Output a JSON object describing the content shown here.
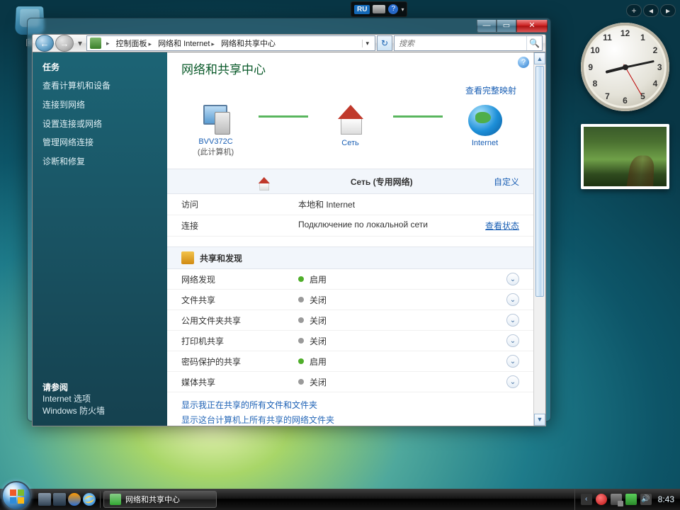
{
  "desktop": {
    "recycle_bin": "回"
  },
  "langbar": {
    "lang": "RU"
  },
  "window": {
    "breadcrumb": {
      "p1": "",
      "p2": "控制面板",
      "p3": "网络和 Internet",
      "p4": "网络和共享中心"
    },
    "search_placeholder": "搜索"
  },
  "sidebar": {
    "tasks_heading": "任务",
    "links": {
      "a": "查看计算机和设备",
      "b": "连接到网络",
      "c": "设置连接或网络",
      "d": "管理网络连接",
      "e": "诊断和修复"
    },
    "seealso": {
      "heading": "请参阅",
      "a": "Internet 选项",
      "b": "Windows 防火墙"
    }
  },
  "main": {
    "title": "网络和共享中心",
    "view_full_map": "查看完整映射",
    "map": {
      "pc": "BVV372C",
      "pc_sub": "(此计算机)",
      "net": "Сеть",
      "inet": "Internet"
    },
    "net_section": {
      "title": "Сеть (专用网络)",
      "customize": "自定义"
    },
    "kv": {
      "access_k": "访问",
      "access_v": "本地和 Internet",
      "conn_k": "连接",
      "conn_v": "Подключение по локальной сети",
      "view_status": "查看状态"
    },
    "share_section": "共享和发现",
    "rows": {
      "r1k": "网络发现",
      "r1v": "启用",
      "r2k": "文件共享",
      "r2v": "关闭",
      "r3k": "公用文件夹共享",
      "r3v": "关闭",
      "r4k": "打印机共享",
      "r4v": "关闭",
      "r5k": "密码保护的共享",
      "r5v": "启用",
      "r6k": "媒体共享",
      "r6v": "关闭"
    },
    "bottom": {
      "a": "显示我正在共享的所有文件和文件夹",
      "b": "显示这台计算机上所有共享的网络文件夹"
    }
  },
  "taskbar": {
    "active": "网络和共享中心",
    "time": "8:43"
  }
}
